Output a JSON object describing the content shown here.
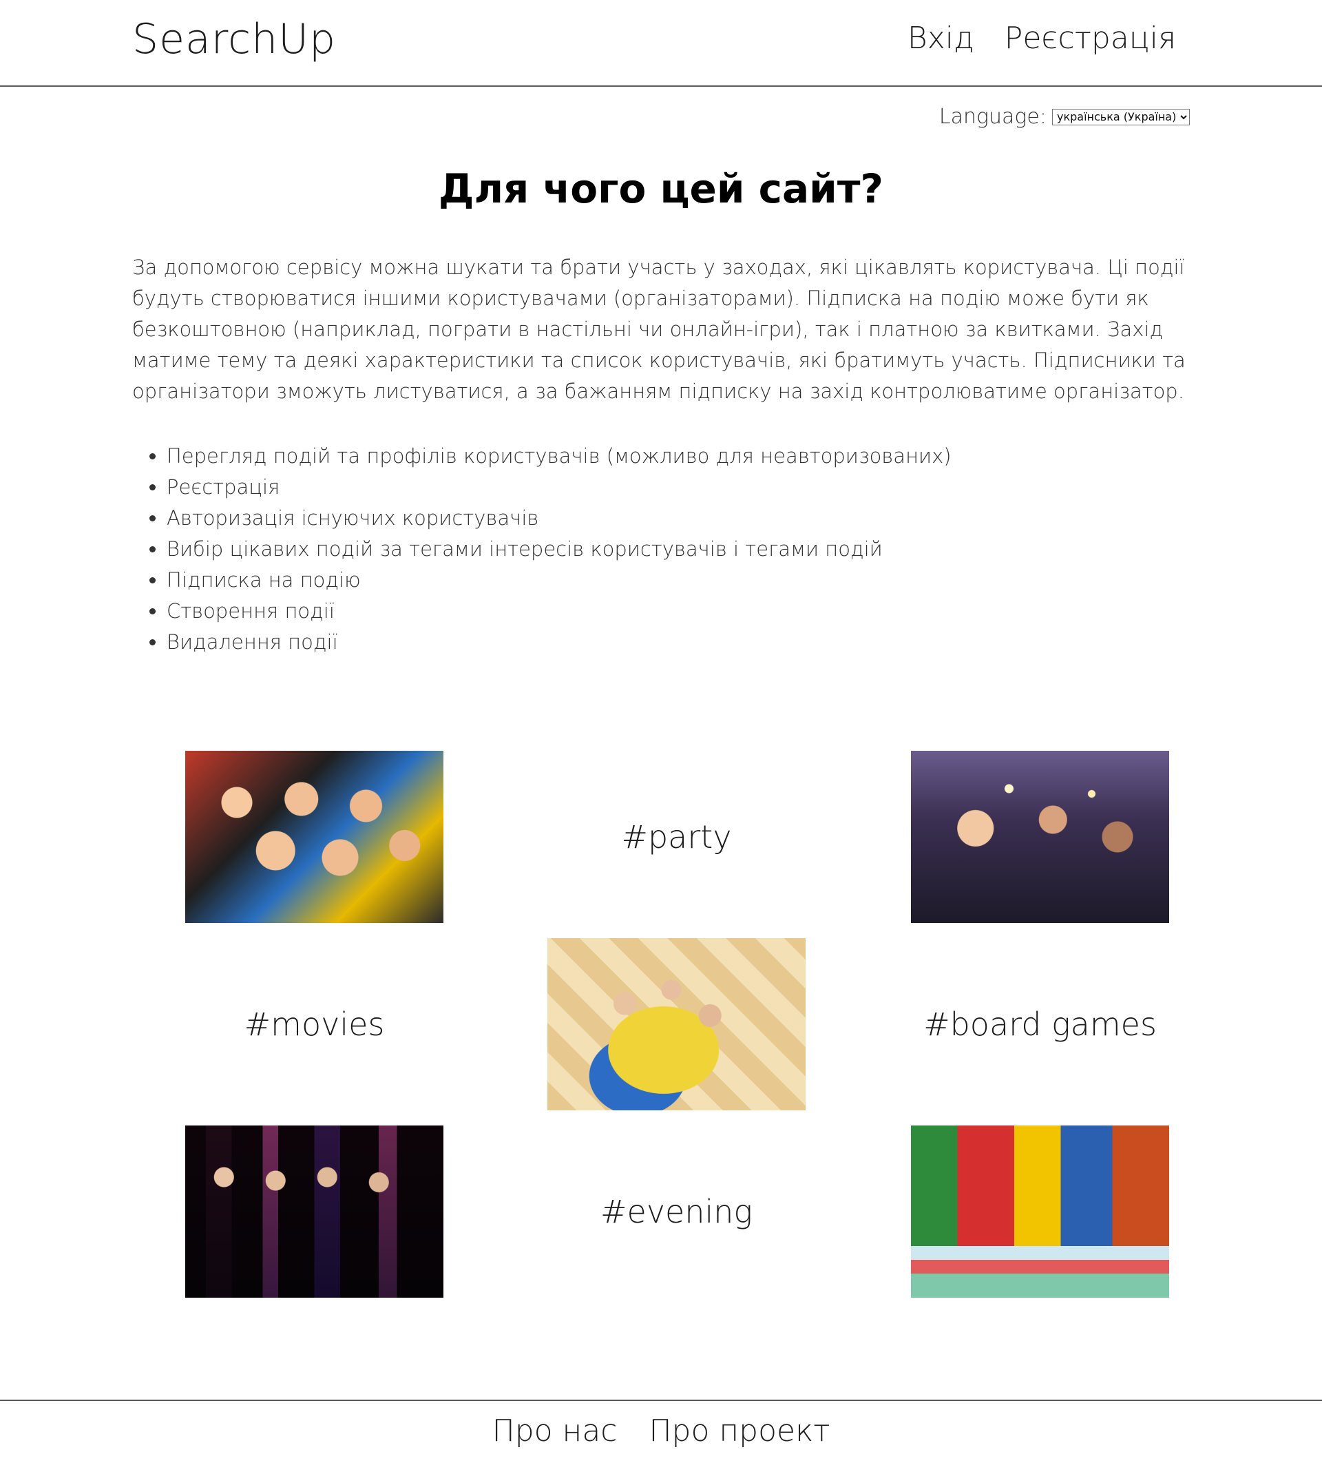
{
  "header": {
    "brand": "SearchUp",
    "nav": {
      "login": "Вхід",
      "register": "Реєстрація"
    }
  },
  "language": {
    "label": "Language:",
    "selected": "українська (Україна)"
  },
  "main": {
    "title": "Для чого цей сайт?",
    "description": "За допомогою сервісу можна шукати та брати участь у заходах, які цікавлять користувача. Ці події будуть створюватися іншими користувачами (організаторами). Підписка на подію може бути як безкоштовною (наприклад, пограти в настільні чи онлайн-ігри), так і платною за квитками. Захід матиме тему та деякі характеристики та список користувачів, які братимуть участь. Підписники та організатори зможуть листуватися, а за бажанням підписку на захід контролюватиме організатор.",
    "features": [
      "Перегляд подій та профілів користувачів (можливо для неавторизованих)",
      "Реєстрація",
      "Авторизація існуючих користувачів",
      "Вибір цікавих подій за тегами інтересів користувачів і тегами подій",
      "Підписка на подію",
      "Створення події",
      "Видалення події"
    ]
  },
  "gallery": {
    "tags": {
      "party": "#party",
      "movies": "#movies",
      "board_games": "#board games",
      "evening": "#evening"
    }
  },
  "footer": {
    "about_us": "Про нас",
    "about_project": "Про проект"
  }
}
